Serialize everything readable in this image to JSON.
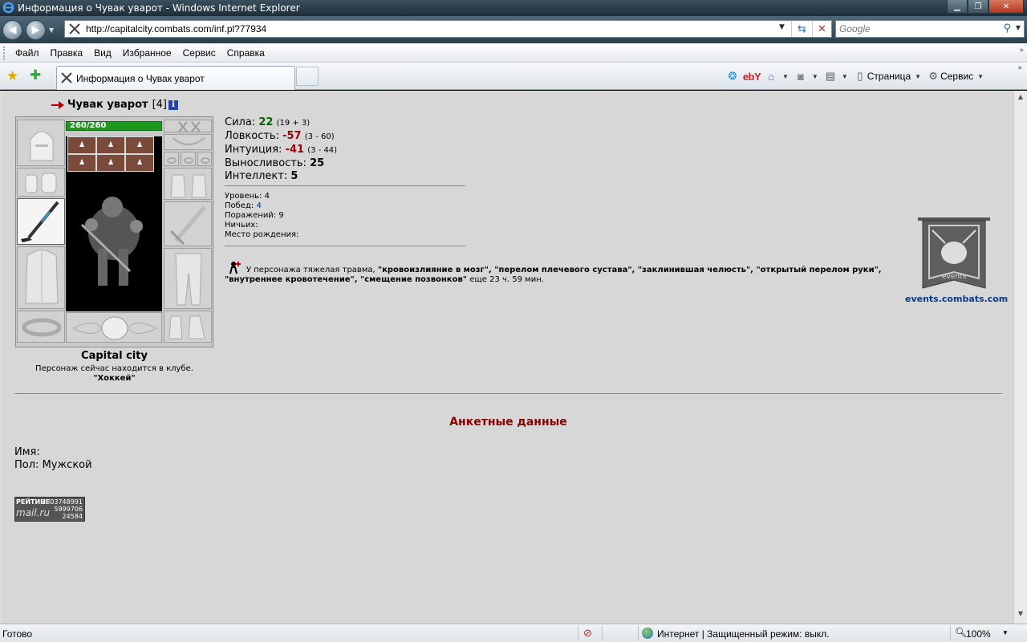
{
  "window": {
    "title": "Информация о Чувак уварот - Windows Internet Explorer",
    "url": "http://capitalcity.combats.com/inf.pl?77934",
    "search_placeholder": "Google"
  },
  "menu": [
    "Файл",
    "Правка",
    "Вид",
    "Избранное",
    "Сервис",
    "Справка"
  ],
  "tab": {
    "label": "Информация о Чувак уварот"
  },
  "command_bar": {
    "page_label": "Страница",
    "tools_label": "Сервис",
    "ebay_label": "ebY"
  },
  "character": {
    "name": "Чувак уварот",
    "level_badge": "[4]",
    "hp": "260/260",
    "city": "Capital city",
    "location": "Персонаж сейчас находится в клубе.",
    "club": "\"Хоккей\""
  },
  "stats": [
    {
      "label": "Сила:",
      "value": "22",
      "extra": "(19 + 3)",
      "tone": "pos"
    },
    {
      "label": "Ловкость:",
      "value": "-57",
      "extra": "(3 - 60)",
      "tone": "neg"
    },
    {
      "label": "Интуиция:",
      "value": "-41",
      "extra": "(3 - 44)",
      "tone": "neg"
    },
    {
      "label": "Выносливость:",
      "value": "25",
      "extra": "",
      "tone": "plain"
    },
    {
      "label": "Интеллект:",
      "value": "5",
      "extra": "",
      "tone": "plain"
    }
  ],
  "records": {
    "level_label": "Уровень:",
    "level": "4",
    "wins_label": "Побед:",
    "wins": "4",
    "losses_label": "Поражений:",
    "losses": "9",
    "draws_label": "Ничьих:",
    "draws": "",
    "birthplace_label": "Место рождения:",
    "birthplace": ""
  },
  "trauma": {
    "prefix": "У персонажа тяжелая травма,",
    "injuries": "\"кровоизлияние в мозг\", \"перелом плечевого сустава\", \"заклинившая челюсть\", \"открытый перелом руки\", \"внутреннее кровотечение\", \"смещение позвонков\"",
    "suffix": "еще 23 ч. 59 мин."
  },
  "events": {
    "logo_text": "events",
    "link": "events.combats.com"
  },
  "profile": {
    "heading": "Анкетные данные",
    "name_label": "Имя:",
    "name_value": "",
    "gender_label": "Пол:",
    "gender_value": "Мужской"
  },
  "counter": {
    "label": "РЕЙТИНГ",
    "brand": "mail.ru",
    "n1": "2603748991",
    "n2": "5999706",
    "n3": "24584"
  },
  "status": {
    "ready": "Готово",
    "zone": "Интернет | Защищенный режим: выкл.",
    "zoom": "100%"
  },
  "colors": {
    "positive": "#006400",
    "negative": "#a00000",
    "heading": "#8b0000",
    "link": "#0b3a84",
    "hp": "#1d9a1d"
  }
}
